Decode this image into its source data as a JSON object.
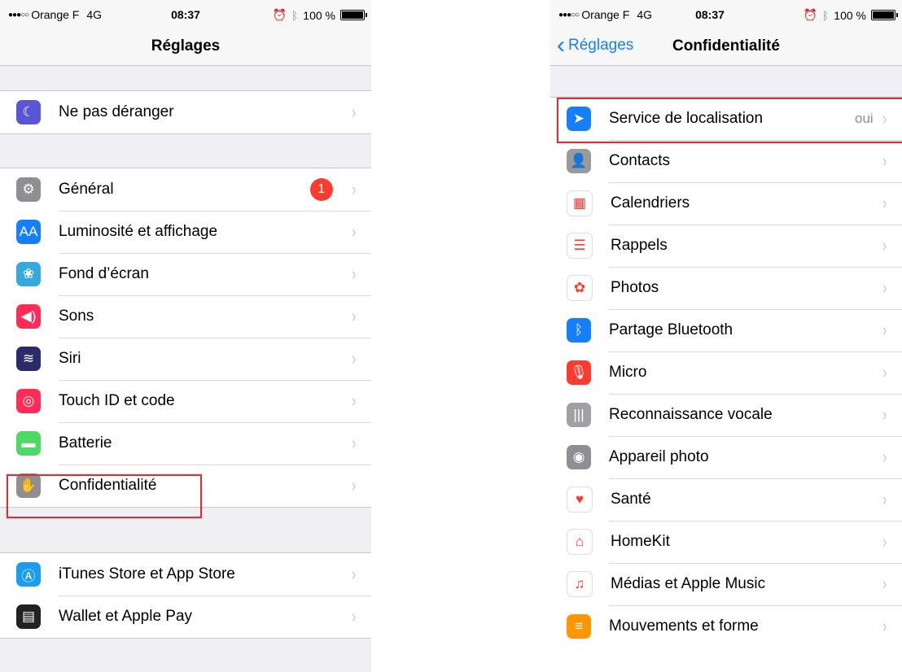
{
  "left": {
    "status": {
      "signal": "●●●○○",
      "carrier": "Orange F",
      "network": "4G",
      "time": "08:37",
      "battery": "100 %"
    },
    "title": "Réglages",
    "section1": [
      {
        "icon": "moon-icon",
        "color": "#5856d6",
        "glyph": "☾",
        "label": "Ne pas déranger"
      }
    ],
    "section2": [
      {
        "icon": "gear-icon",
        "color": "#8e8e93",
        "glyph": "⚙",
        "label": "Général",
        "badge": "1"
      },
      {
        "icon": "display-icon",
        "color": "#147efb",
        "glyph": "AA",
        "label": "Luminosité et affichage"
      },
      {
        "icon": "wallpaper-icon",
        "color": "#34aadc",
        "glyph": "❀",
        "label": "Fond d’écran"
      },
      {
        "icon": "speaker-icon",
        "color": "#ff2d55",
        "glyph": "◀)",
        "label": "Sons"
      },
      {
        "icon": "siri-icon",
        "color": "#2b2b6b",
        "glyph": "≋",
        "label": "Siri"
      },
      {
        "icon": "fingerprint-icon",
        "color": "#ff2d55",
        "glyph": "◎",
        "label": "Touch ID et code"
      },
      {
        "icon": "battery-icon",
        "color": "#4cd964",
        "glyph": "▬",
        "label": "Batterie"
      },
      {
        "icon": "hand-icon",
        "color": "#8e8e93",
        "glyph": "✋",
        "label": "Confidentialité"
      }
    ],
    "section3": [
      {
        "icon": "appstore-icon",
        "color": "#1a9cf0",
        "glyph": "Ⓐ",
        "label": "iTunes Store et App Store"
      },
      {
        "icon": "wallet-icon",
        "color": "#222222",
        "glyph": "▤",
        "label": "Wallet et Apple Pay"
      }
    ]
  },
  "right": {
    "status": {
      "signal": "●●●○○",
      "carrier": "Orange F",
      "network": "4G",
      "time": "08:37",
      "battery": "100 %"
    },
    "back": "Réglages",
    "title": "Confidentialité",
    "rows": [
      {
        "icon": "location-arrow-icon",
        "color": "#147efb",
        "glyph": "➤",
        "label": "Service de localisation",
        "value": "oui"
      },
      {
        "icon": "contacts-icon",
        "color": "#9a9a9a",
        "glyph": "👤",
        "label": "Contacts"
      },
      {
        "icon": "calendar-icon",
        "color": "#ffffff",
        "glyph": "▦",
        "label": "Calendriers"
      },
      {
        "icon": "reminders-icon",
        "color": "#ffffff",
        "glyph": "☰",
        "label": "Rappels"
      },
      {
        "icon": "photos-icon",
        "color": "#ffffff",
        "glyph": "✿",
        "label": "Photos"
      },
      {
        "icon": "bluetooth-icon",
        "color": "#147efb",
        "glyph": "ᛒ",
        "label": "Partage Bluetooth"
      },
      {
        "icon": "microphone-icon",
        "color": "#ff3b30",
        "glyph": "🎙",
        "label": "Micro"
      },
      {
        "icon": "waveform-icon",
        "color": "#a0a0a6",
        "glyph": "|||",
        "label": "Reconnaissance vocale"
      },
      {
        "icon": "camera-icon",
        "color": "#8e8e93",
        "glyph": "◉",
        "label": "Appareil photo"
      },
      {
        "icon": "heart-icon",
        "color": "#ffffff",
        "glyph": "♥",
        "label": "Santé"
      },
      {
        "icon": "home-icon",
        "color": "#ffffff",
        "glyph": "⌂",
        "label": "HomeKit"
      },
      {
        "icon": "music-icon",
        "color": "#ffffff",
        "glyph": "♫",
        "label": "Médias et Apple Music"
      },
      {
        "icon": "motion-icon",
        "color": "#ff9500",
        "glyph": "≡",
        "label": "Mouvements et forme"
      }
    ]
  }
}
